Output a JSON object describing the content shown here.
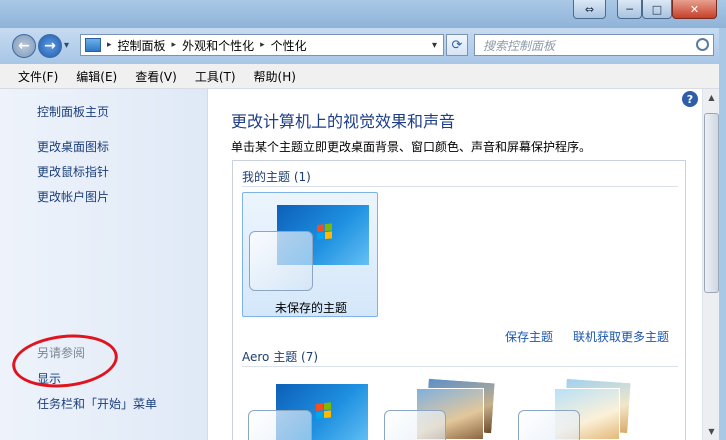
{
  "window": {
    "caption_buttons": [
      "⇔",
      "─",
      "□",
      "✕"
    ]
  },
  "navigation": {
    "back_arrow": "←",
    "forward_arrow": "→",
    "breadcrumb": [
      "控制面板",
      "外观和个性化",
      "个性化"
    ],
    "separator": "▸",
    "dropdown": "▾",
    "refresh": "⟳",
    "search_placeholder": "搜索控制面板"
  },
  "menu": [
    "文件(F)",
    "编辑(E)",
    "查看(V)",
    "工具(T)",
    "帮助(H)"
  ],
  "sidebar": {
    "home": "控制面板主页",
    "links": [
      "更改桌面图标",
      "更改鼠标指针",
      "更改帐户图片"
    ],
    "see_also": "另请参阅",
    "see_links": [
      "显示",
      "任务栏和「开始」菜单"
    ]
  },
  "main": {
    "heading": "更改计算机上的视觉效果和声音",
    "description": "单击某个主题立即更改桌面背景、窗口颜色、声音和屏幕保护程序。",
    "my_themes_label": "我的主题 (1)",
    "selected_theme": "未保存的主题",
    "save_theme": "保存主题",
    "get_more": "联机获取更多主题",
    "aero_label": "Aero 主题 (7)",
    "help": "?"
  }
}
